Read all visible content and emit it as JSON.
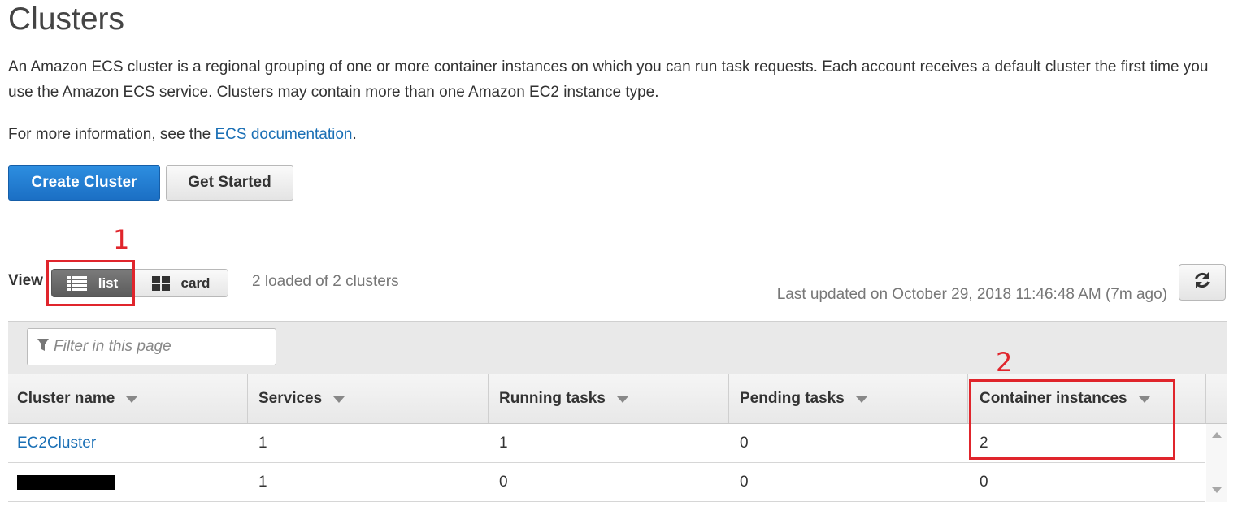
{
  "page": {
    "title": "Clusters",
    "description": "An Amazon ECS cluster is a regional grouping of one or more container instances on which you can run task requests. Each account receives a default cluster the first time you use the Amazon ECS service. Clusters may contain more than one Amazon EC2 instance type.",
    "more_info_prefix": "For more information, see the ",
    "more_info_link": "ECS documentation",
    "more_info_suffix": "."
  },
  "buttons": {
    "create_cluster": "Create Cluster",
    "get_started": "Get Started"
  },
  "view": {
    "label": "View",
    "list": "list",
    "card": "card",
    "selected": "list"
  },
  "status": {
    "loaded": "2 loaded of 2 clusters",
    "last_updated": "Last updated on October 29, 2018 11:46:48 AM (7m ago)"
  },
  "filter": {
    "placeholder": "Filter in this page"
  },
  "annotations": [
    "1",
    "2"
  ],
  "table": {
    "columns": [
      "Cluster name",
      "Services",
      "Running tasks",
      "Pending tasks",
      "Container instances"
    ],
    "rows": [
      {
        "name": "EC2Cluster",
        "redacted": false,
        "services": "1",
        "running": "1",
        "pending": "0",
        "instances": "2"
      },
      {
        "name": "",
        "redacted": true,
        "services": "1",
        "running": "0",
        "pending": "0",
        "instances": "0"
      }
    ]
  },
  "colors": {
    "primary_button": "#1b6fc4",
    "link": "#1a6fb5",
    "annotation": "#e0252c",
    "selected_segment": "#5c5c5c"
  }
}
